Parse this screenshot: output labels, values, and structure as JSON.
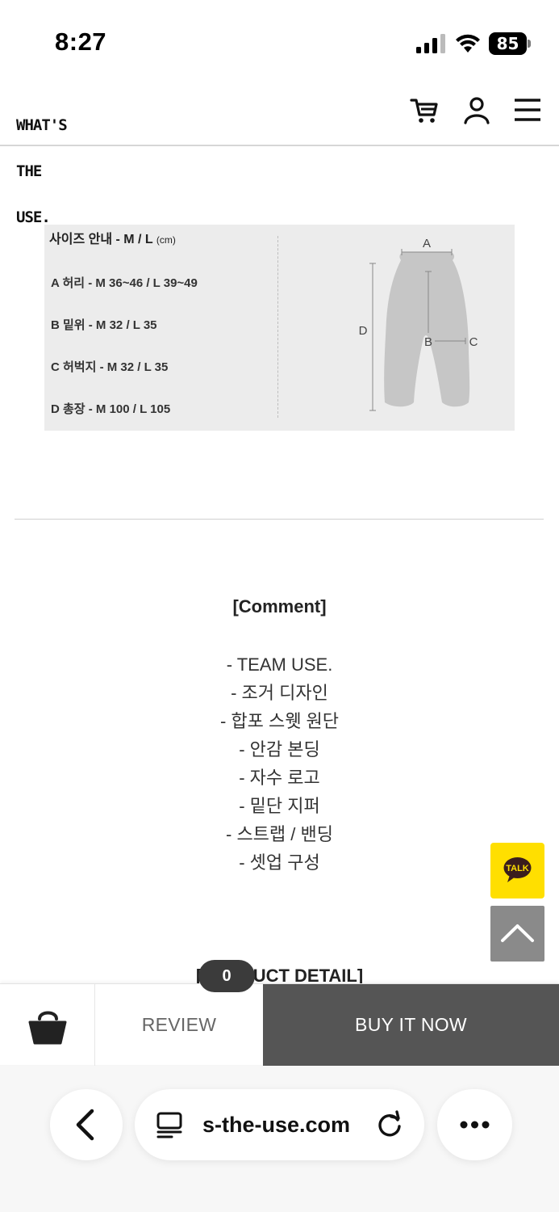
{
  "status_bar": {
    "time": "8:27",
    "battery": "85",
    "icons": [
      "signal-icon",
      "wifi-icon",
      "battery-icon"
    ]
  },
  "header": {
    "logo_lines": [
      "WHAT'S",
      "THE",
      "USE."
    ],
    "icons": [
      "cart-icon",
      "account-icon",
      "menu-icon"
    ]
  },
  "size_guide": {
    "title": "사이즈 안내 - M / L",
    "unit": "(cm)",
    "rows": [
      "A 허리 -  M 36~46 / L 39~49",
      "B 밑위 - M 32 / L 35",
      "C 허벅지 - M 32 / L 35",
      "D 총장 - M 100 / L 105"
    ],
    "diagram_labels": {
      "a": "A",
      "b": "B",
      "c": "C",
      "d": "D"
    },
    "pants_color": "#c6c6c6"
  },
  "comment": {
    "title": "[Comment]",
    "lines": [
      "- TEAM USE.",
      "- 조거 디자인",
      "- 합포 스웻 원단",
      "- 안감 본딩",
      "- 자수 로고",
      "- 밑단 지퍼",
      "- 스트랩 / 밴딩",
      "- 셋업 구성"
    ]
  },
  "product_detail": {
    "title": "[PRODUCT DETAIL]"
  },
  "floating": {
    "kakao_label": "TALK",
    "kakao_color": "#ffdf00",
    "scroll_top_icon": "chevron-up-icon"
  },
  "badge": {
    "count": "0"
  },
  "purchase_bar": {
    "basket_icon": "basket-icon",
    "review_label": "REVIEW",
    "buy_label": "BUY IT NOW",
    "buy_color": "#555555"
  },
  "browser": {
    "url": "s-the-use.com",
    "icons": [
      "back-icon",
      "tabs-icon",
      "reload-icon",
      "more-icon"
    ]
  }
}
